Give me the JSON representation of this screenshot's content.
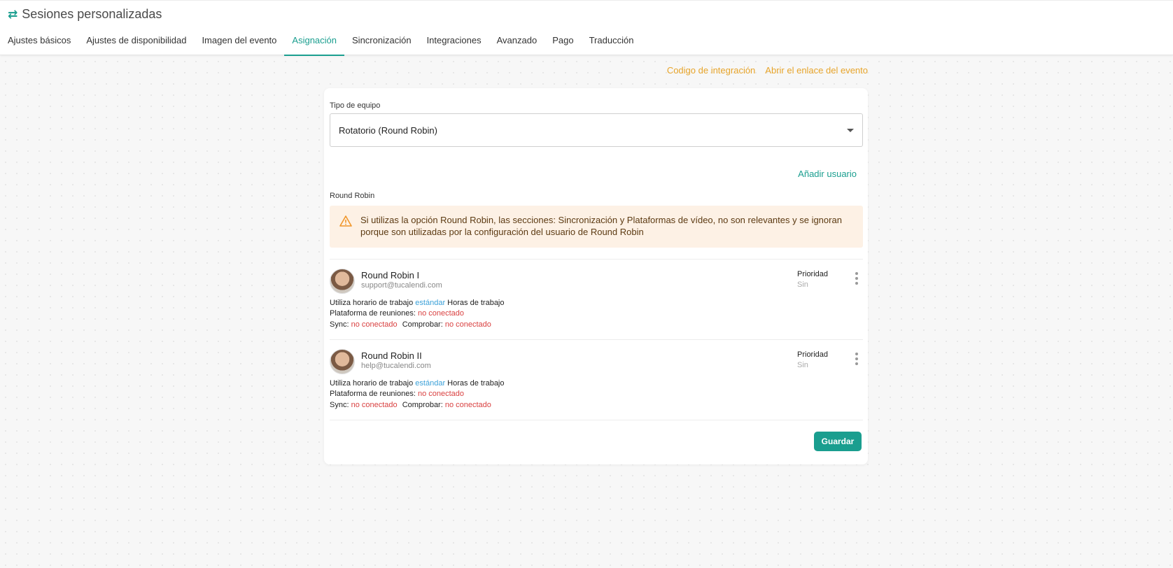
{
  "header": {
    "title": "Sesiones personalizadas",
    "icon": "swap-arrows-icon",
    "accent_color": "#1a9e8f"
  },
  "tabs": [
    {
      "label": "Ajustes básicos"
    },
    {
      "label": "Ajustes de disponibilidad"
    },
    {
      "label": "Imagen del evento"
    },
    {
      "label": "Asignación",
      "active": true
    },
    {
      "label": "Sincronización"
    },
    {
      "label": "Integraciones"
    },
    {
      "label": "Avanzado"
    },
    {
      "label": "Pago"
    },
    {
      "label": "Traducción"
    }
  ],
  "top_links": {
    "integration_code": "Codigo de integración",
    "open_event_link": "Abrir el enlace del evento",
    "color": "#e7a42a"
  },
  "team_type": {
    "label": "Tipo de equipo",
    "selected": "Rotatorio (Round Robin)"
  },
  "add_user_label": "Añadir usuario",
  "section_label": "Round Robin",
  "alert": {
    "icon": "warning-triangle-icon",
    "text_line1": "Si utilizas la opción Round Robin, las secciones: Sincronización y Plataformas de vídeo, no son relevantes y se ignoran",
    "text_line2": "porque son utilizadas por la configuración del usuario de Round Robin"
  },
  "users": [
    {
      "name": "Round Robin I",
      "email": "support@tucalendi.com",
      "priority_label": "Prioridad",
      "priority_value": "Sin",
      "schedule_prefix": "Utiliza horario de trabajo",
      "schedule_type": "estándar",
      "schedule_suffix": "Horas de trabajo",
      "platform_label": "Plataforma de reuniones:",
      "platform_value": "no conectado",
      "sync_label": "Sync:",
      "sync_value": "no conectado",
      "check_label": "Comprobar:",
      "check_value": "no conectado"
    },
    {
      "name": "Round Robin II",
      "email": "help@tucalendi.com",
      "priority_label": "Prioridad",
      "priority_value": "Sin",
      "schedule_prefix": "Utiliza horario de trabajo",
      "schedule_type": "estándar",
      "schedule_suffix": "Horas de trabajo",
      "platform_label": "Plataforma de reuniones:",
      "platform_value": "no conectado",
      "sync_label": "Sync:",
      "sync_value": "no conectado",
      "check_label": "Comprobar:",
      "check_value": "no conectado"
    }
  ],
  "save_label": "Guardar"
}
